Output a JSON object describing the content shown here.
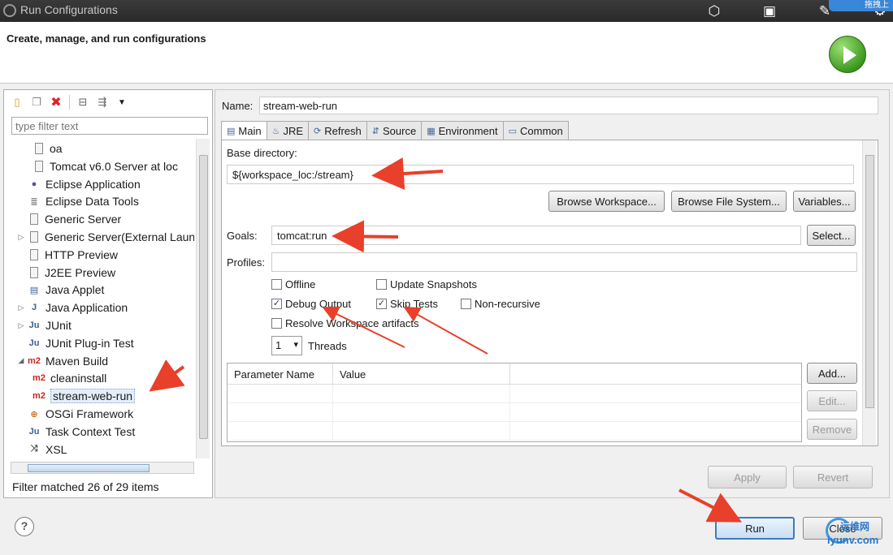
{
  "window": {
    "title": "Run Configurations",
    "badge": "拖拽上"
  },
  "overlay_icons": [
    "share-icon",
    "screen-icon",
    "pen-icon",
    "settings-icon"
  ],
  "header": {
    "heading": "Create, manage, and run configurations"
  },
  "left": {
    "toolbar": [
      "new-config-icon",
      "duplicate-icon",
      "delete-icon",
      "collapse-all-icon",
      "filter-icon",
      "view-menu-icon"
    ],
    "filter_placeholder": "type filter text",
    "tree": [
      {
        "label": "oa",
        "icon": "server-icon",
        "level": 2,
        "arrow": ""
      },
      {
        "label": "Tomcat v6.0 Server at loc",
        "icon": "server-icon",
        "level": 2,
        "arrow": ""
      },
      {
        "label": "Eclipse Application",
        "icon": "eclipse-icon",
        "level": 1,
        "arrow": ""
      },
      {
        "label": "Eclipse Data Tools",
        "icon": "database-icon",
        "level": 1,
        "arrow": ""
      },
      {
        "label": "Generic Server",
        "icon": "server-icon",
        "level": 1,
        "arrow": ""
      },
      {
        "label": "Generic Server(External Laun",
        "icon": "server-icon",
        "level": 1,
        "arrow": "▷"
      },
      {
        "label": "HTTP Preview",
        "icon": "server-icon",
        "level": 1,
        "arrow": ""
      },
      {
        "label": "J2EE Preview",
        "icon": "server-icon",
        "level": 1,
        "arrow": ""
      },
      {
        "label": "Java Applet",
        "icon": "applet-icon",
        "level": 1,
        "arrow": ""
      },
      {
        "label": "Java Application",
        "icon": "java-app-icon",
        "level": 1,
        "arrow": "▷"
      },
      {
        "label": "JUnit",
        "icon": "junit-icon",
        "level": 1,
        "arrow": "▷"
      },
      {
        "label": "JUnit Plug-in Test",
        "icon": "junit-plugin-icon",
        "level": 1,
        "arrow": ""
      },
      {
        "label": "Maven Build",
        "icon": "maven-icon",
        "level": 1,
        "arrow": "◢"
      },
      {
        "label": "cleaninstall",
        "icon": "maven-icon",
        "level": 2,
        "arrow": ""
      },
      {
        "label": "stream-web-run",
        "icon": "maven-icon",
        "level": 2,
        "arrow": "",
        "selected": true
      },
      {
        "label": "OSGi Framework",
        "icon": "osgi-icon",
        "level": 1,
        "arrow": ""
      },
      {
        "label": "Task Context Test",
        "icon": "task-icon",
        "level": 1,
        "arrow": ""
      },
      {
        "label": "XSL",
        "icon": "xsl-icon",
        "level": 1,
        "arrow": ""
      }
    ],
    "status": "Filter matched 26 of 29 items"
  },
  "right": {
    "name_label": "Name:",
    "name_value": "stream-web-run",
    "tabs": [
      {
        "label": "Main",
        "icon": "main-tab-icon",
        "active": true
      },
      {
        "label": "JRE",
        "icon": "jre-icon"
      },
      {
        "label": "Refresh",
        "icon": "refresh-icon"
      },
      {
        "label": "Source",
        "icon": "source-icon"
      },
      {
        "label": "Environment",
        "icon": "environment-icon"
      },
      {
        "label": "Common",
        "icon": "common-icon"
      }
    ],
    "base_dir_label": "Base directory:",
    "base_dir_value": "${workspace_loc:/stream}",
    "browse_workspace": "Browse Workspace...",
    "browse_fs": "Browse File System...",
    "variables": "Variables...",
    "goals_label": "Goals:",
    "goals_value": "tomcat:run",
    "select": "Select...",
    "profiles_label": "Profiles:",
    "profiles_value": "",
    "checkboxes": {
      "offline": {
        "label": "Offline",
        "checked": false
      },
      "update_snapshots": {
        "label": "Update Snapshots",
        "checked": false
      },
      "debug_output": {
        "label": "Debug Output",
        "checked": true
      },
      "skip_tests": {
        "label": "Skip Tests",
        "checked": true
      },
      "non_recursive": {
        "label": "Non-recursive",
        "checked": false
      },
      "resolve_workspace": {
        "label": "Resolve Workspace artifacts",
        "checked": false
      }
    },
    "threads_value": "1",
    "threads_label": "Threads",
    "param_table": {
      "columns": [
        "Parameter Name",
        "Value"
      ],
      "rows": []
    },
    "add": "Add...",
    "edit": "Edit...",
    "remove": "Remove",
    "apply": "Apply",
    "revert": "Revert"
  },
  "footer": {
    "help": "?",
    "run": "Run",
    "close": "Close"
  },
  "watermark": {
    "cn": "运维网",
    "url": "iyunv.com"
  },
  "annotation_color": "#e8402a"
}
